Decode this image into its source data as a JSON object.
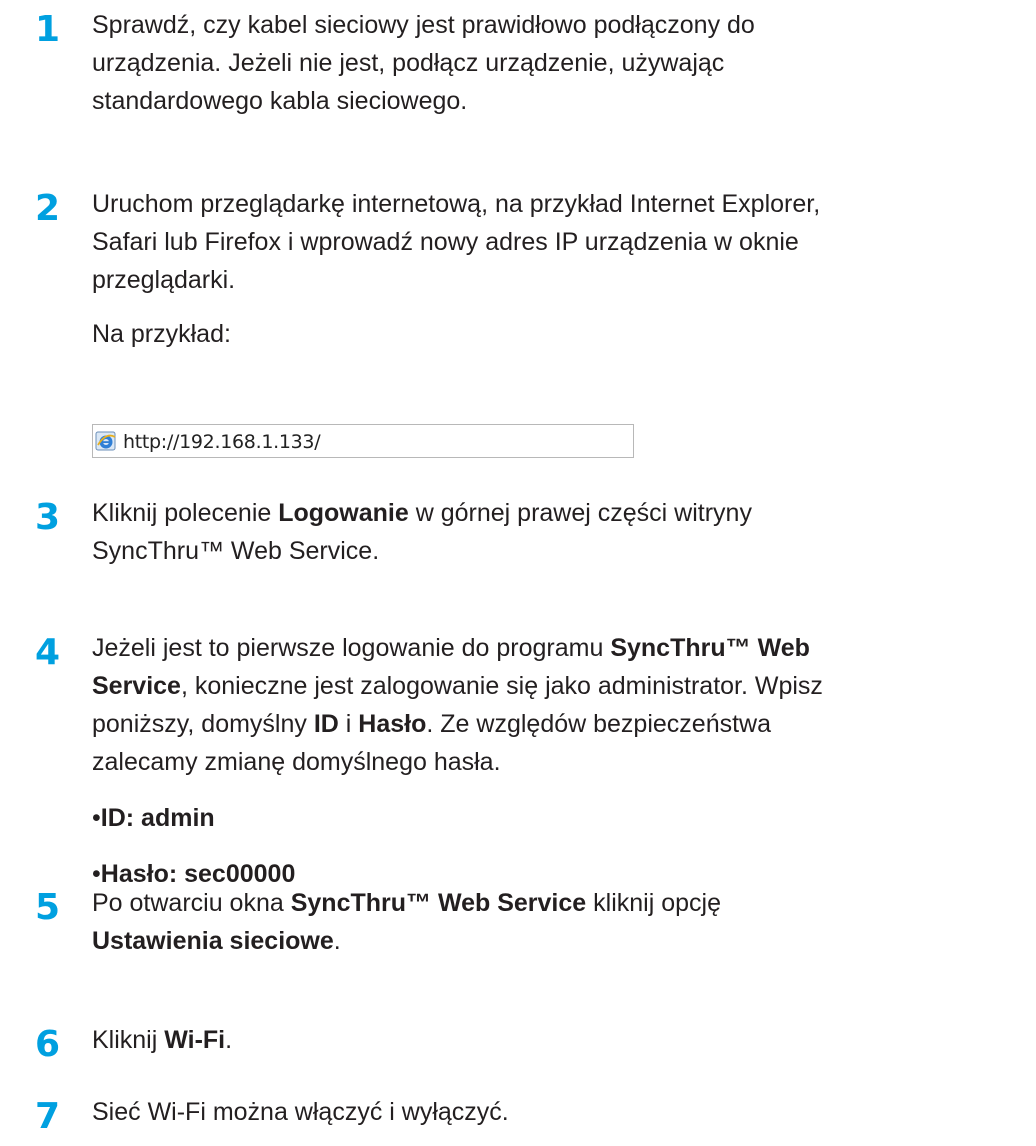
{
  "steps": [
    {
      "number": "1",
      "lines": [
        "Sprawdź, czy kabel sieciowy jest prawidłowo podłączony do",
        "urządzenia. Jeżeli nie jest, podłącz urządzenie, używając",
        "standardowego kabla sieciowego."
      ]
    },
    {
      "number": "2",
      "lines": [
        "Uruchom przeglądarkę internetową, na przykład Internet Explorer,",
        "Safari lub Firefox i wprowadź nowy adres IP urządzenia w oknie",
        "przeglądarki."
      ],
      "example_label": "Na przykład:",
      "url": "http://192.168.1.133/"
    },
    {
      "number": "3",
      "line1_a": "Kliknij polecenie ",
      "line1_b": "Logowanie",
      "line1_c": " w górnej prawej części witryny",
      "line2": "SyncThru™ Web Service."
    },
    {
      "number": "4",
      "line1_a": "Jeżeli jest to pierwsze logowanie do programu ",
      "line1_b": "SyncThru™ Web",
      "line2_a": "Service",
      "line2_b": ", konieczne jest zalogowanie się jako administrator. Wpisz",
      "line3_a": "poniższy, domyślny ",
      "line3_b": "ID",
      "line3_c": " i ",
      "line3_d": "Hasło",
      "line3_e": ". Ze względów bezpieczeństwa",
      "line4": "zalecamy zmianę domyślnego hasła.",
      "bullets": [
        "ID: admin",
        "Hasło: sec00000"
      ]
    },
    {
      "number": "5",
      "line1_a": "Po otwarciu okna ",
      "line1_b": "SyncThru™ Web Service",
      "line1_c": " kliknij opcję",
      "line2_a": "Ustawienia sieciowe",
      "line2_b": "."
    },
    {
      "number": "6",
      "line1_a": "Kliknij ",
      "line1_b": "Wi-Fi",
      "line1_c": "."
    },
    {
      "number": "7",
      "line1": "Sieć Wi-Fi można włączyć i wyłączyć."
    }
  ]
}
